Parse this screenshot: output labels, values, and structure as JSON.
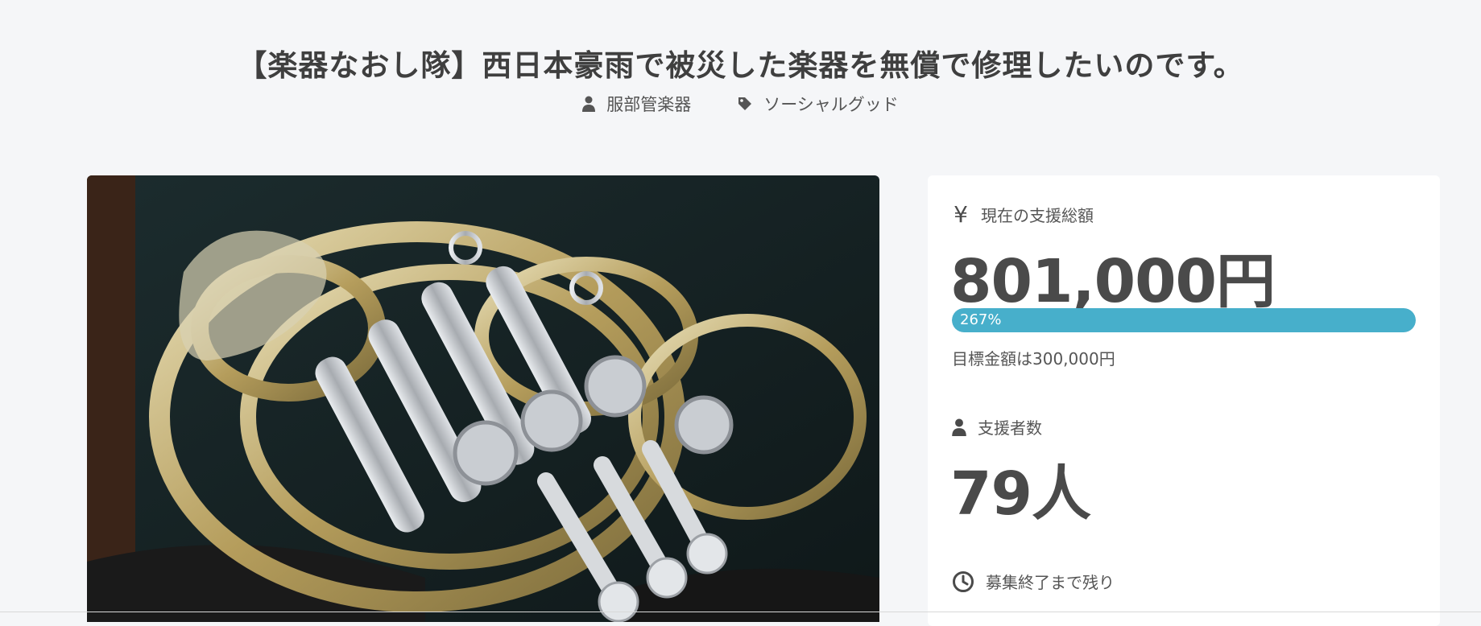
{
  "project": {
    "title": "【楽器なおし隊】西日本豪雨で被災した楽器を無償で修理したいのです。",
    "owner": "服部管楽器",
    "category": "ソーシャルグッド",
    "image_alt": "ケースに入った被災したフレンチホルン"
  },
  "funding": {
    "label": "現在の支援総額",
    "amount": "801,000円",
    "percent_text": "267%",
    "progress": 1.0,
    "goal_text": "目標金額は300,000円"
  },
  "supporters": {
    "label": "支援者数",
    "count": "79人"
  },
  "remaining": {
    "label": "募集終了まで残り"
  },
  "icons": {
    "owner": "person-icon",
    "category": "tag-icon",
    "funding": "yen-icon",
    "supporters": "person-icon",
    "remaining": "clock-icon"
  },
  "colors": {
    "progress": "#47afcb",
    "background": "#f5f6f8",
    "text": "#444444"
  }
}
